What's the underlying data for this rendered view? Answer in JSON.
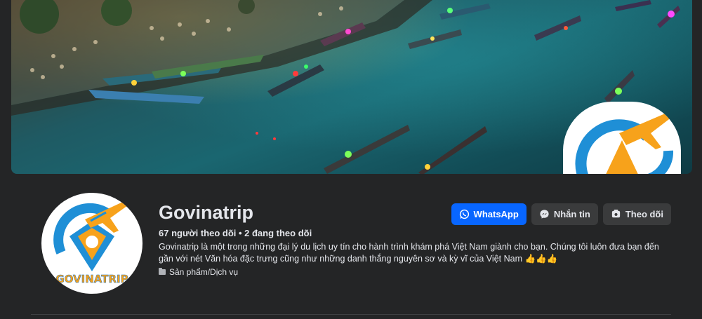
{
  "profile": {
    "name": "Govinatrip",
    "followers_text": "67 người theo dõi • 2 đang theo dõi",
    "bio_line1": "Govinatrip là một trong những đại lý du lịch uy tín cho hành trình khám phá Việt Nam giành cho bạn. Chúng tôi luôn đưa bạn đến",
    "bio_line2": "gần với nét Văn hóa đặc trưng cũng như những danh thắng nguyên sơ và kỳ vĩ của Việt Nam 👍👍👍",
    "category": "Sản phẩm/Dịch vụ",
    "logo_text": "GOVINATRIP"
  },
  "actions": {
    "whatsapp_label": "WhatsApp",
    "message_label": "Nhắn tin",
    "follow_label": "Theo dõi"
  },
  "icons": {
    "whatsapp": "whatsapp-icon",
    "messenger": "messenger-icon",
    "follow": "follow-icon",
    "category": "folder-icon"
  },
  "colors": {
    "background": "#242526",
    "primary_button": "#0866ff",
    "secondary_button": "#3a3b3c",
    "logo_blue": "#1f8fd6",
    "logo_orange": "#f7a21b"
  }
}
